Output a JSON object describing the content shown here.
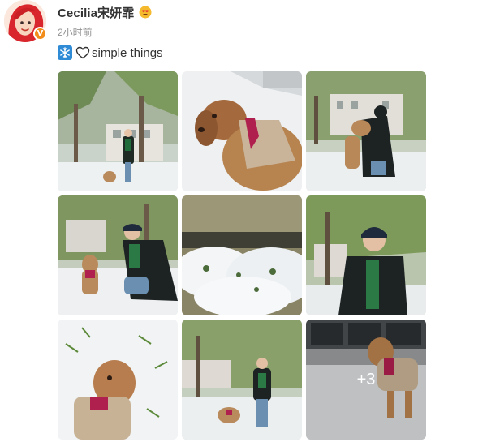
{
  "post": {
    "author": {
      "name": "Cecilia宋妍霏",
      "verified": true,
      "badge_color": "#f28c1a",
      "emoji_icon": "heart-eyes-emoji-icon"
    },
    "timestamp": "2小时前",
    "text": "simple things",
    "text_icons": [
      "snowflake-icon",
      "heart-outline-icon"
    ],
    "images": [
      {
        "id": "1",
        "description": "woman and dog in snowy park"
      },
      {
        "id": "2",
        "description": "dog in sweater close-up in snow"
      },
      {
        "id": "3",
        "description": "woman hugging dog in snow"
      },
      {
        "id": "4",
        "description": "woman crouching beside dog"
      },
      {
        "id": "5",
        "description": "snow-covered bushes"
      },
      {
        "id": "6",
        "description": "woman looking up at tree"
      },
      {
        "id": "7",
        "description": "dog close-up in snow"
      },
      {
        "id": "8",
        "description": "woman walking dog"
      },
      {
        "id": "9",
        "description": "dog in sweater, more photos"
      }
    ],
    "more_count_label": "+3"
  }
}
